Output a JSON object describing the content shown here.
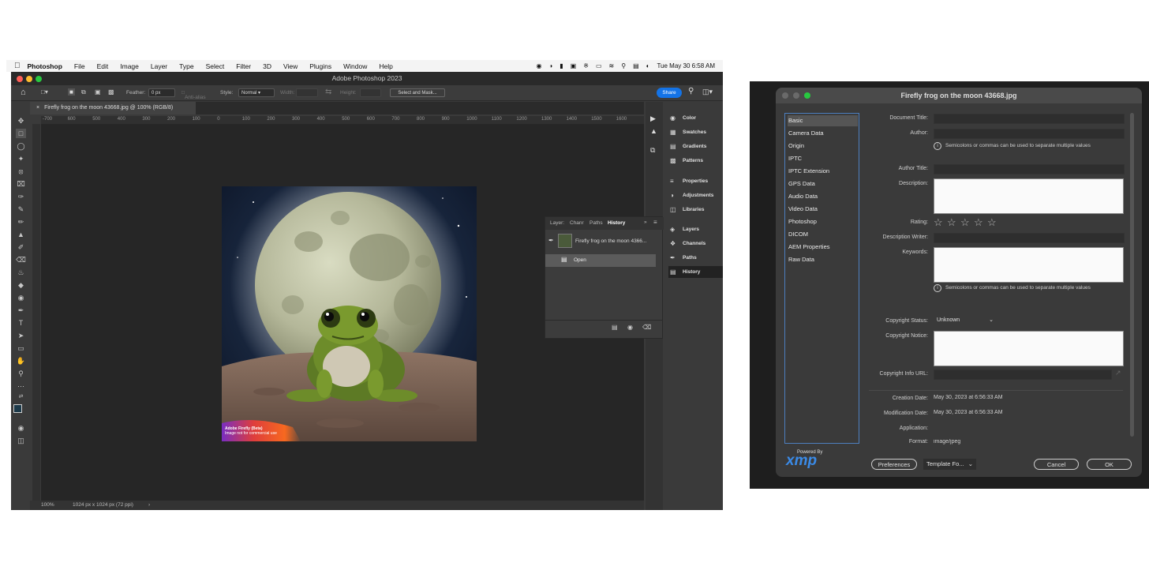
{
  "menubar": {
    "app_name": "Photoshop",
    "items": [
      "File",
      "Edit",
      "Image",
      "Layer",
      "Type",
      "Select",
      "Filter",
      "3D",
      "View",
      "Plugins",
      "Window",
      "Help"
    ],
    "clock": "Tue May 30  6:58 AM"
  },
  "ps": {
    "window_title": "Adobe Photoshop 2023",
    "options": {
      "feather_label": "Feather:",
      "feather_value": "0 px",
      "antialias_label": "Anti-alias",
      "style_label": "Style:",
      "style_value": "Normal",
      "width_label": "Width:",
      "height_label": "Height:",
      "select_mask_label": "Select and Mask...",
      "share_label": "Share"
    },
    "doc_tab": "Firefly frog on the moon 43668.jpg @ 100% (RGB/8)",
    "ruler_ticks": [
      "-700",
      "600",
      "500",
      "400",
      "300",
      "200",
      "100",
      "0",
      "100",
      "200",
      "300",
      "400",
      "500",
      "600",
      "700",
      "800",
      "900",
      "1000",
      "1100",
      "1200",
      "1300",
      "1400",
      "1500",
      "1600"
    ],
    "watermark_line1": "Adobe Firefly (Beta)",
    "watermark_line2": "Image not for commercial use",
    "status_zoom": "100%",
    "status_info": "1024 px x 1024 px (72 ppi)",
    "right_panels": [
      "Color",
      "Swatches",
      "Gradients",
      "Patterns",
      "Properties",
      "Adjustments",
      "Libraries",
      "Layers",
      "Channels",
      "Paths",
      "History"
    ],
    "history_panel": {
      "tabs": [
        "Layer:",
        "Chanr",
        "Paths",
        "History"
      ],
      "snapshot_label": "Firefly frog on the moon 4366...",
      "step_label": "Open"
    }
  },
  "dialog": {
    "title": "Firefly frog on the moon 43668.jpg",
    "sidebar": [
      "Basic",
      "Camera Data",
      "Origin",
      "IPTC",
      "IPTC Extension",
      "GPS Data",
      "Audio Data",
      "Video Data",
      "Photoshop",
      "DICOM",
      "AEM Properties",
      "Raw Data"
    ],
    "labels": {
      "document_title": "Document Title:",
      "author": "Author:",
      "author_title": "Author Title:",
      "description": "Description:",
      "rating": "Rating:",
      "description_writer": "Description Writer:",
      "keywords": "Keywords:",
      "copyright_status": "Copyright Status:",
      "copyright_notice": "Copyright Notice:",
      "copyright_url": "Copyright Info URL:",
      "creation_date": "Creation Date:",
      "modification_date": "Modification Date:",
      "application": "Application:",
      "format": "Format:"
    },
    "hint": "Semicolons or commas can be used to separate multiple values",
    "copyright_status_value": "Unknown",
    "creation_date_value": "May 30, 2023 at 6:56:33 AM",
    "modification_date_value": "May 30, 2023 at 6:56:33 AM",
    "format_value": "image/jpeg",
    "rating_value": 0,
    "powered_by": "Powered By",
    "xmp_logo": "xmp",
    "buttons": {
      "preferences": "Preferences",
      "template": "Template Fo...",
      "cancel": "Cancel",
      "ok": "OK"
    }
  },
  "colors": {
    "accent": "#1473e6",
    "ps_bg": "#3a3a3a",
    "canvas_bg": "#262626",
    "dialog_bg": "#3a3a3a"
  }
}
